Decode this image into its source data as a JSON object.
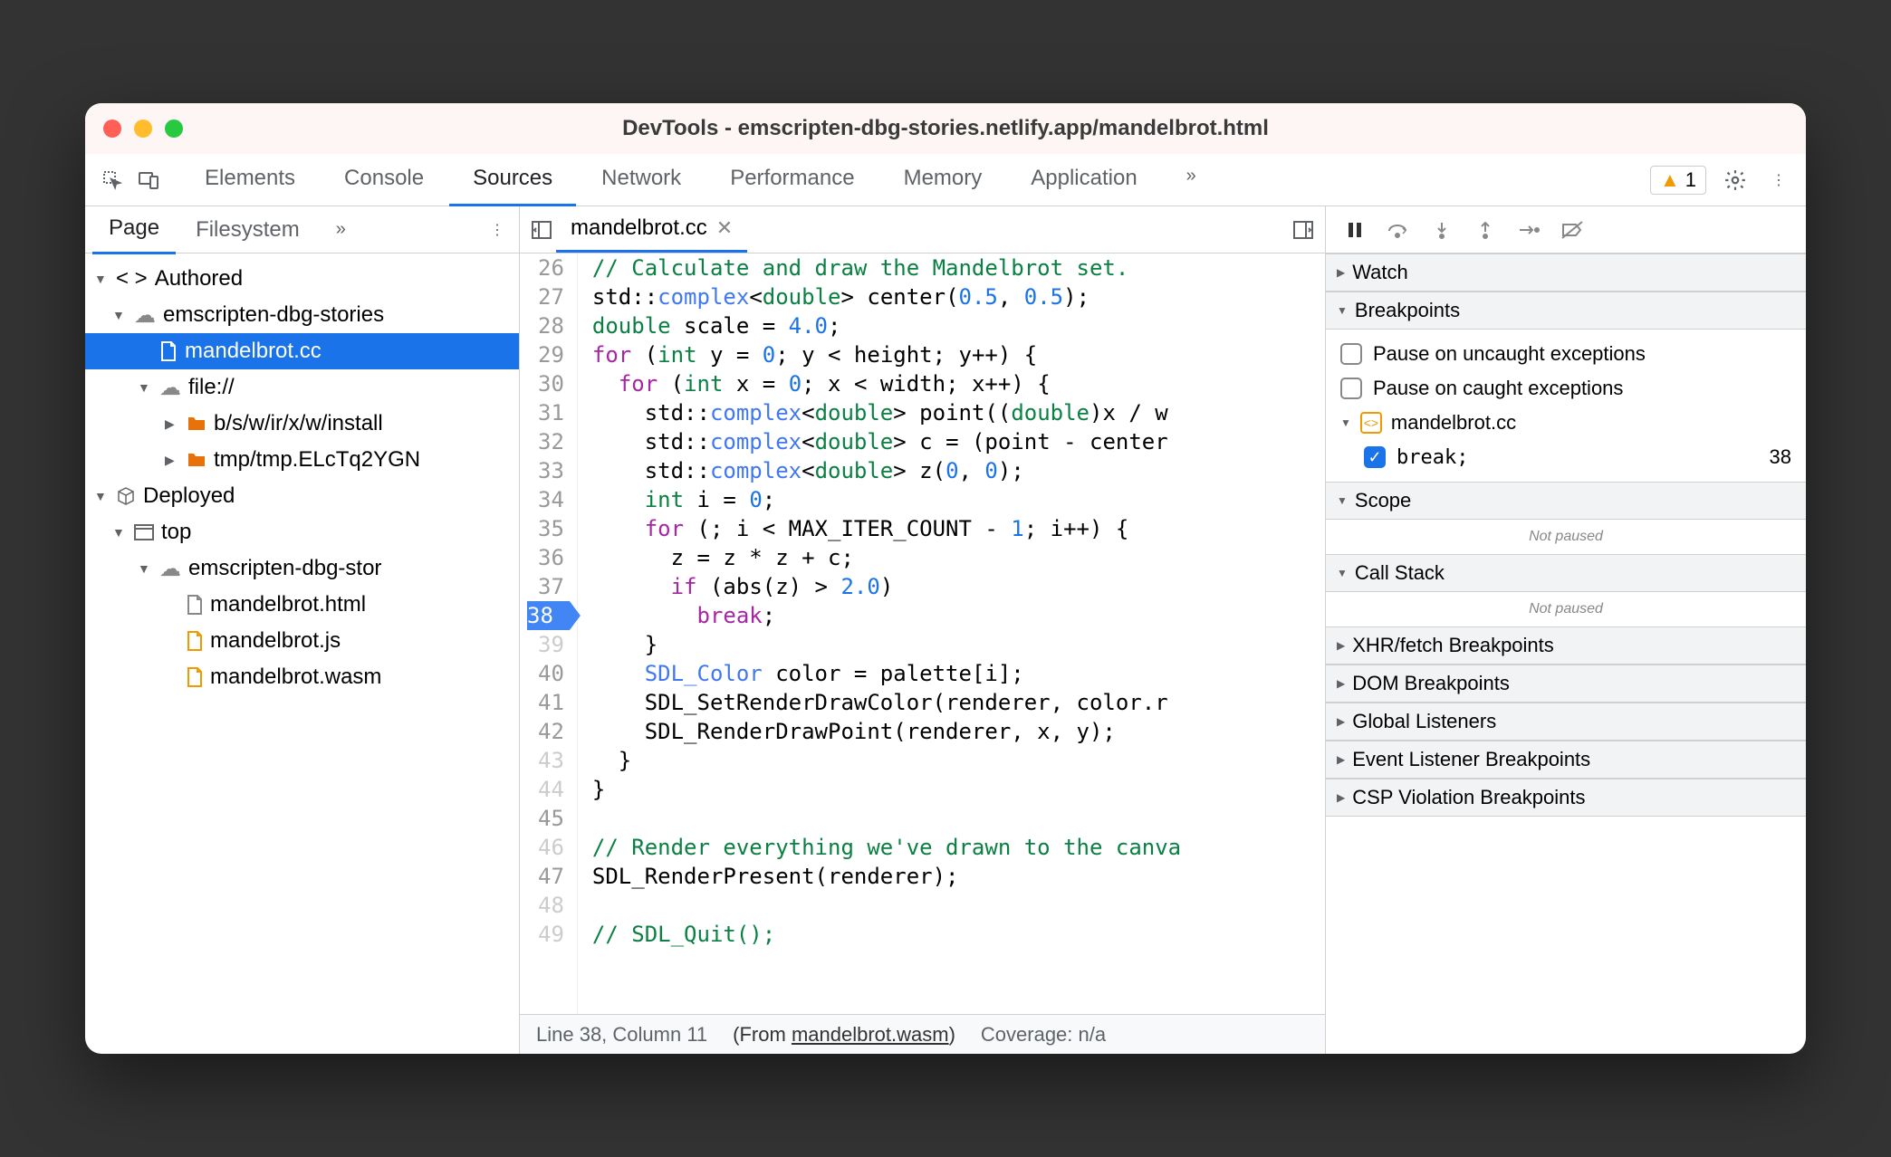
{
  "titlebar": {
    "title": "DevTools - emscripten-dbg-stories.netlify.app/mandelbrot.html"
  },
  "toolbar": {
    "tabs": [
      "Elements",
      "Console",
      "Sources",
      "Network",
      "Performance",
      "Memory",
      "Application"
    ],
    "active_tab": "Sources",
    "warning_count": "1"
  },
  "sidebar": {
    "tabs": [
      "Page",
      "Filesystem"
    ],
    "active": "Page",
    "tree": {
      "authored": "Authored",
      "domain1": "emscripten-dbg-stories",
      "file_selected": "mandelbrot.cc",
      "file_scheme": "file://",
      "folder1": "b/s/w/ir/x/w/install",
      "folder2": "tmp/tmp.ELcTq2YGN",
      "deployed": "Deployed",
      "top": "top",
      "domain2": "emscripten-dbg-stor",
      "f1": "mandelbrot.html",
      "f2": "mandelbrot.js",
      "f3": "mandelbrot.wasm"
    }
  },
  "editor": {
    "open_file": "mandelbrot.cc",
    "breakpoint_line": 38,
    "lines": [
      {
        "n": 26,
        "html": "<span class='c-comment'>// Calculate and draw the Mandelbrot set.</span>"
      },
      {
        "n": 27,
        "html": "std::<span class='c-fn'>complex</span>&lt;<span class='c-type'>double</span>&gt; center(<span class='c-num'>0.5</span>, <span class='c-num'>0.5</span>);"
      },
      {
        "n": 28,
        "html": "<span class='c-type'>double</span> scale = <span class='c-num'>4.0</span>;"
      },
      {
        "n": 29,
        "html": "<span class='c-kw'>for</span> (<span class='c-type'>int</span> y = <span class='c-num'>0</span>; y &lt; height; y++) {"
      },
      {
        "n": 30,
        "html": "  <span class='c-kw'>for</span> (<span class='c-type'>int</span> x = <span class='c-num'>0</span>; x &lt; width; x++) {"
      },
      {
        "n": 31,
        "html": "    std::<span class='c-fn'>complex</span>&lt;<span class='c-type'>double</span>&gt; point((<span class='c-type'>double</span>)x / w"
      },
      {
        "n": 32,
        "html": "    std::<span class='c-fn'>complex</span>&lt;<span class='c-type'>double</span>&gt; c = (point - center"
      },
      {
        "n": 33,
        "html": "    std::<span class='c-fn'>complex</span>&lt;<span class='c-type'>double</span>&gt; z(<span class='c-num'>0</span>, <span class='c-num'>0</span>);"
      },
      {
        "n": 34,
        "html": "    <span class='c-type'>int</span> i = <span class='c-num'>0</span>;"
      },
      {
        "n": 35,
        "html": "    <span class='c-kw'>for</span> (; i &lt; MAX_ITER_COUNT - <span class='c-num'>1</span>; i++) {"
      },
      {
        "n": 36,
        "html": "      z = z * z + c;"
      },
      {
        "n": 37,
        "html": "      <span class='c-kw'>if</span> (abs(z) &gt; <span class='c-num'>2.0</span>)"
      },
      {
        "n": 38,
        "html": "        <span class='c-stmt'>break</span>;",
        "bp": true
      },
      {
        "n": 39,
        "html": "    }",
        "dim": true
      },
      {
        "n": 40,
        "html": "    <span class='c-fn'>SDL_Color</span> color = palette[i];"
      },
      {
        "n": 41,
        "html": "    SDL_SetRenderDrawColor(renderer, color.r"
      },
      {
        "n": 42,
        "html": "    SDL_RenderDrawPoint(renderer, x, y);"
      },
      {
        "n": 43,
        "html": "  }",
        "dim": true
      },
      {
        "n": 44,
        "html": "}",
        "dim": true
      },
      {
        "n": 45,
        "html": ""
      },
      {
        "n": 46,
        "html": "<span class='c-comment'>// Render everything we've drawn to the canva</span>",
        "dim": true
      },
      {
        "n": 47,
        "html": "SDL_RenderPresent(renderer);"
      },
      {
        "n": 48,
        "html": "",
        "dim": true
      },
      {
        "n": 49,
        "html": "<span class='c-comment'>// SDL_Quit();</span>",
        "dim": true
      }
    ],
    "status": {
      "pos": "Line 38, Column 11",
      "from_label": "(From ",
      "from_file": "mandelbrot.wasm",
      "from_close": ")",
      "coverage": "Coverage: n/a"
    }
  },
  "debugger": {
    "sections": {
      "watch": "Watch",
      "breakpoints": "Breakpoints",
      "pause_uncaught": "Pause on uncaught exceptions",
      "pause_caught": "Pause on caught exceptions",
      "bp_file": "mandelbrot.cc",
      "bp_text": "break;",
      "bp_line": "38",
      "scope": "Scope",
      "not_paused": "Not paused",
      "callstack": "Call Stack",
      "xhr": "XHR/fetch Breakpoints",
      "dom": "DOM Breakpoints",
      "global": "Global Listeners",
      "event": "Event Listener Breakpoints",
      "csp": "CSP Violation Breakpoints"
    }
  }
}
